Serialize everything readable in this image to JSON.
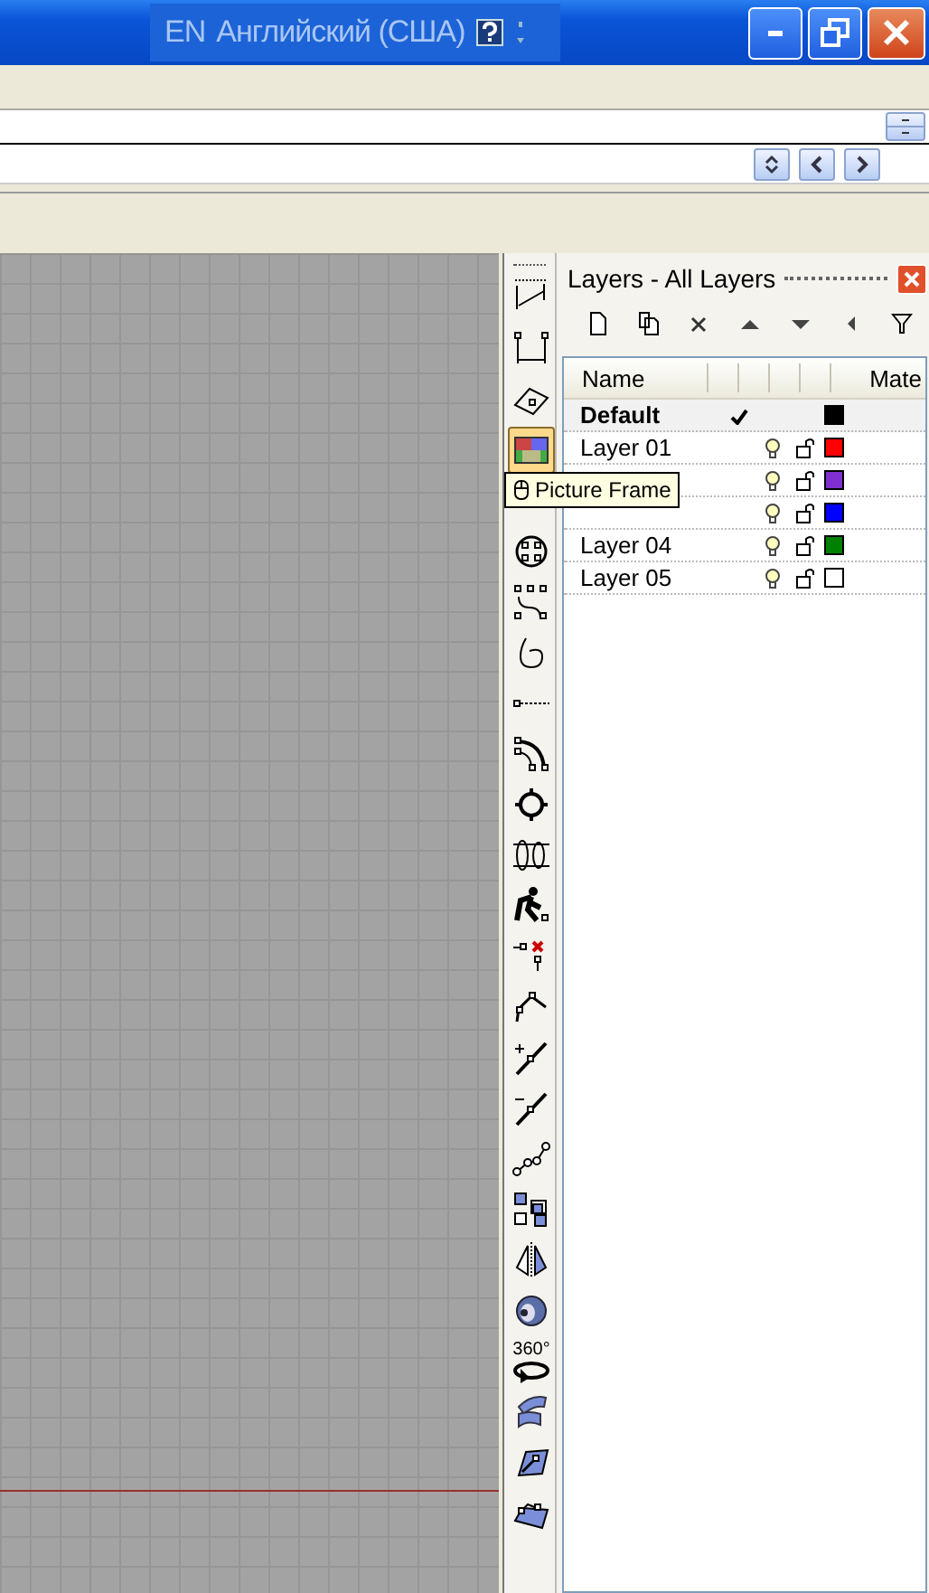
{
  "title_bar": {
    "language_code": "EN",
    "language_name": "Английский (США)"
  },
  "tools": [
    {
      "kind": "dimension-aligned",
      "selected": false
    },
    {
      "kind": "dimension-linear",
      "selected": false
    },
    {
      "kind": "plane",
      "selected": false
    },
    {
      "kind": "picture-frame",
      "selected": true,
      "tooltip": "Picture Frame"
    },
    {
      "kind": "circle-points",
      "selected": false
    },
    {
      "kind": "control-points",
      "selected": false
    },
    {
      "kind": "loop-curve",
      "selected": false
    },
    {
      "kind": "dotted-line",
      "selected": false
    },
    {
      "kind": "arc-points",
      "selected": false
    },
    {
      "kind": "gear",
      "selected": false
    },
    {
      "kind": "cylinder",
      "selected": false
    },
    {
      "kind": "figure",
      "selected": false
    },
    {
      "kind": "delete-point",
      "selected": false
    },
    {
      "kind": "polyline",
      "selected": false
    },
    {
      "kind": "insert-point",
      "selected": false
    },
    {
      "kind": "remove-point",
      "selected": false
    },
    {
      "kind": "point-chain",
      "selected": false
    },
    {
      "kind": "squares",
      "selected": false
    },
    {
      "kind": "mirror",
      "selected": false
    },
    {
      "kind": "sphere",
      "selected": false
    },
    {
      "kind": "rotate",
      "selected": false,
      "label": "360°"
    },
    {
      "kind": "surface",
      "selected": false
    },
    {
      "kind": "plane-edit",
      "selected": false
    },
    {
      "kind": "plane-points",
      "selected": false
    }
  ],
  "layers_panel": {
    "title": "Layers - All Layers",
    "columns": [
      "Name",
      "Mate"
    ],
    "rows": [
      {
        "kind": "default",
        "name": "Default",
        "current": true,
        "color": "#000000"
      },
      {
        "kind": "layer",
        "name": "Layer 01",
        "current": false,
        "locked": false,
        "color": "#ff0000"
      },
      {
        "kind": "layer",
        "current": false,
        "locked": false,
        "color": "#8030d0"
      },
      {
        "kind": "layer",
        "current": false,
        "locked": false,
        "color": "#0000ff"
      },
      {
        "kind": "layer",
        "name": "Layer 04",
        "current": false,
        "locked": false,
        "color": "#008000"
      },
      {
        "kind": "layer",
        "name": "Layer 05",
        "current": false,
        "locked": false,
        "color": "#ffffff"
      }
    ]
  }
}
